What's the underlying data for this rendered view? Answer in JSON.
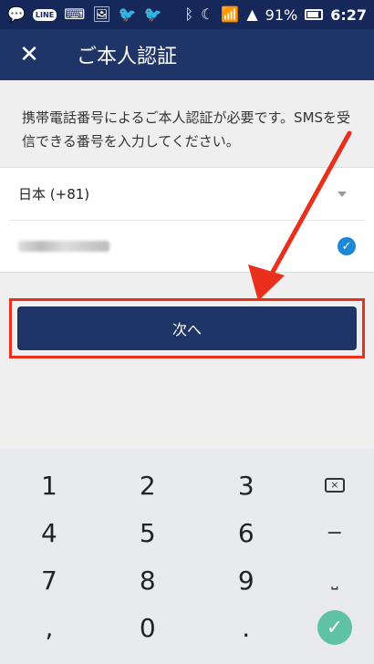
{
  "status_bar": {
    "line_label": "LINE",
    "battery": "91%",
    "time": "6:27"
  },
  "app_bar": {
    "close_glyph": "✕",
    "title": "ご本人認証"
  },
  "info": {
    "text": "携帯電話番号によるご本人認証が必要です。SMSを受信できる番号を入力してください。"
  },
  "form": {
    "country": "日本 (+81)",
    "phone_value": ""
  },
  "next_button": {
    "label": "次へ"
  },
  "keyboard": {
    "rows": [
      [
        "1",
        "2",
        "3"
      ],
      [
        "4",
        "5",
        "6"
      ],
      [
        "7",
        "8",
        "9"
      ],
      [
        ",",
        "0",
        "."
      ]
    ],
    "actions": [
      "⌫",
      "−",
      "␣",
      "✓"
    ]
  },
  "colors": {
    "accent": "#1f3568",
    "status_bar": "#16285a",
    "highlight": "#e8301c",
    "check": "#1e88d8",
    "done": "#5fc2a4"
  }
}
